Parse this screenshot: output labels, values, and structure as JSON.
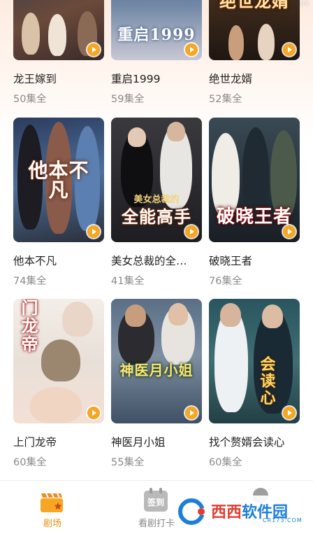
{
  "status": {
    "speed": "/m/s"
  },
  "colors": {
    "accent": "#f5a623",
    "tab_active": "#e8910e",
    "muted": "#8a8a8a"
  },
  "rows": [
    [
      {
        "title": "龙王嫁到",
        "episodes": "50集全",
        "poster_text": ""
      },
      {
        "title": "重启1999",
        "episodes": "59集全",
        "poster_text": "重启1999"
      },
      {
        "title": "绝世龙婿",
        "episodes": "52集全",
        "poster_text": "绝世龙婿"
      }
    ],
    [
      {
        "title": "他本不凡",
        "episodes": "74集全",
        "poster_text": "他本不凡"
      },
      {
        "title": "美女总裁的全…",
        "episodes": "41集全",
        "poster_text": "全能高手",
        "poster_sub": "美女总裁的"
      },
      {
        "title": "破晓王者",
        "episodes": "76集全",
        "poster_text": "破晓王者"
      }
    ],
    [
      {
        "title": "上门龙帝",
        "episodes": "60集全",
        "poster_text": "上门龙帝"
      },
      {
        "title": "神医月小姐",
        "episodes": "55集全",
        "poster_text": "神医月小姐"
      },
      {
        "title": "找个赘婿会读心",
        "episodes": "60集全",
        "poster_text": "会读心"
      }
    ]
  ],
  "tabs": [
    {
      "label": "剧场",
      "icon": "clapperboard-icon",
      "active": true
    },
    {
      "label": "看剧打卡",
      "icon": "calendar-checkin-icon",
      "badge": "签到",
      "active": false
    },
    {
      "label": "我的",
      "icon": "profile-icon",
      "active": false
    }
  ],
  "watermark": {
    "text_red": "西西",
    "text_blue": "软件园",
    "sub": "CR173.COM"
  }
}
